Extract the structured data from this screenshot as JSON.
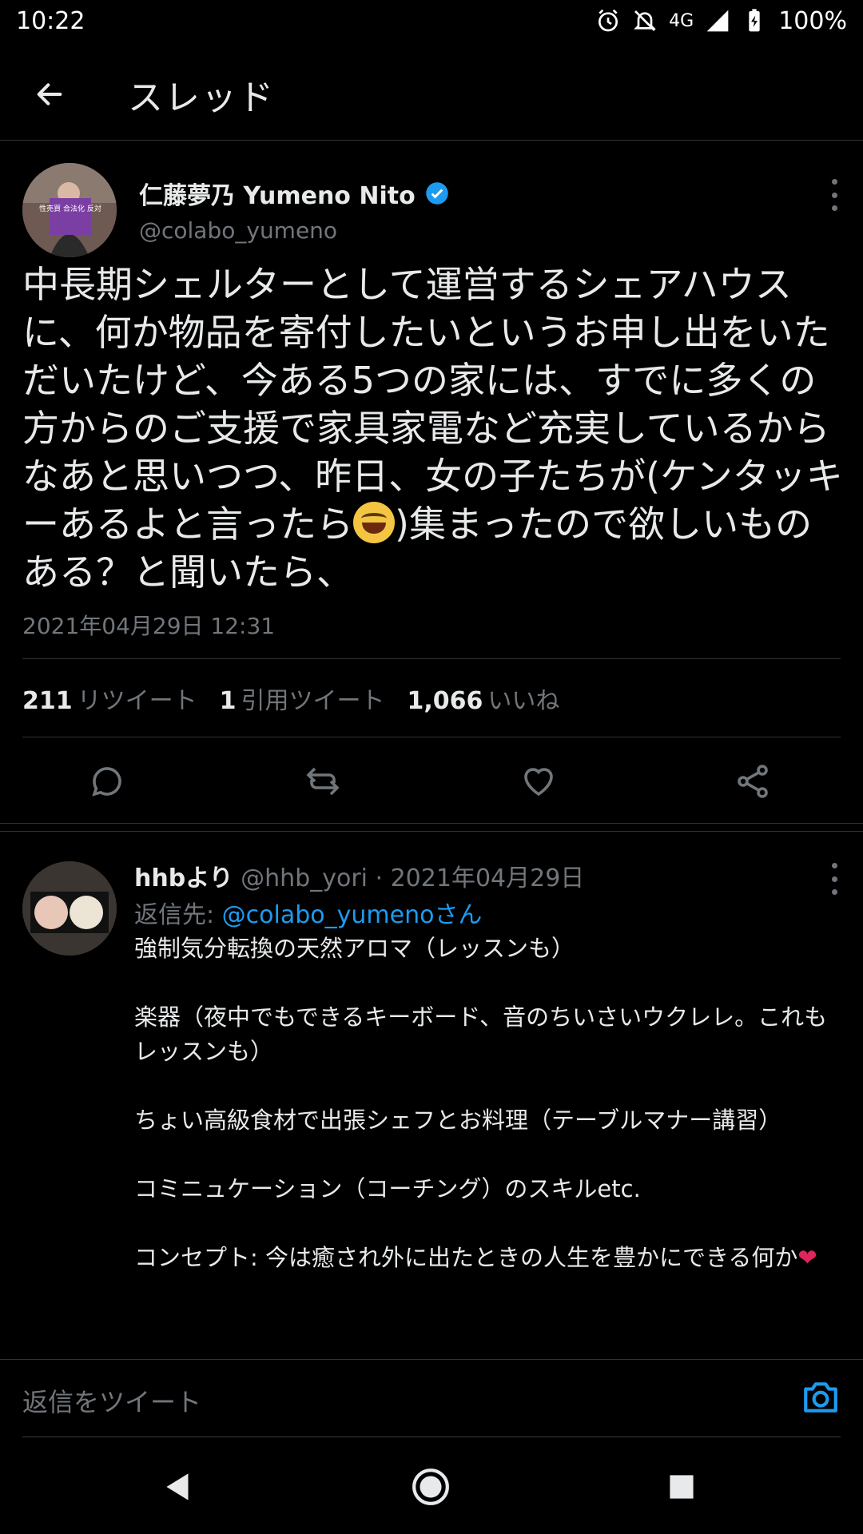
{
  "status_bar": {
    "time": "10:22",
    "network": "4G",
    "battery": "100%",
    "icons": [
      "alarm-icon",
      "notifications-off-icon",
      "signal-icon",
      "battery-icon"
    ]
  },
  "header": {
    "title": "スレッド",
    "back_icon": "arrow-left-icon"
  },
  "main_tweet": {
    "name": "仁藤夢乃 Yumeno Nito",
    "handle": "@colabo_yumeno",
    "verified": true,
    "avatar_sign_text": "性売買 合法化 反対",
    "text_part1": "中長期シェルターとして運営するシェアハウスに、何か物品を寄付したいというお申し出をいただいたけど、今ある5つの家には、すでに多くの方からのご支援で家具家電など充実しているからなあと思いつつ、昨日、女の子たちが(ケンタッキーあるよと言ったら",
    "text_part2": ")集まったので欲しいものある？と聞いたら、",
    "date": "2021年04月29日 12:31",
    "stats": {
      "retweets_count": "211",
      "retweets_label": "リツイート",
      "quotes_count": "1",
      "quotes_label": "引用ツイート",
      "likes_count": "1,066",
      "likes_label": "いいね"
    },
    "actions": [
      "reply-icon",
      "retweet-icon",
      "like-icon",
      "share-icon"
    ]
  },
  "reply": {
    "name": "hhbより",
    "handle_date": "@hhb_yori · 2021年04月29日",
    "reply_to_label": "返信先:",
    "reply_to_mention": "@colabo_yumenoさん",
    "paragraphs": [
      "強制気分転換の天然アロマ（レッスンも）",
      "楽器（夜中でもできるキーボード、音のちいさいウクレレ。これもレッスンも）",
      "ちょい高級食材で出張シェフとお料理（テーブルマナー講習）",
      "コミニュケーション（コーチング）のスキルetc."
    ],
    "last_paragraph": "コンセプト: 今は癒され外に出たときの人生を豊かにできる何か",
    "heart": "❤"
  },
  "compose": {
    "placeholder": "返信をツイート",
    "camera_icon": "camera-icon"
  },
  "colors": {
    "background": "#000000",
    "text": "#e7e9ea",
    "secondary": "#71767b",
    "accent": "#1d9bf0",
    "border": "#2f3336"
  }
}
